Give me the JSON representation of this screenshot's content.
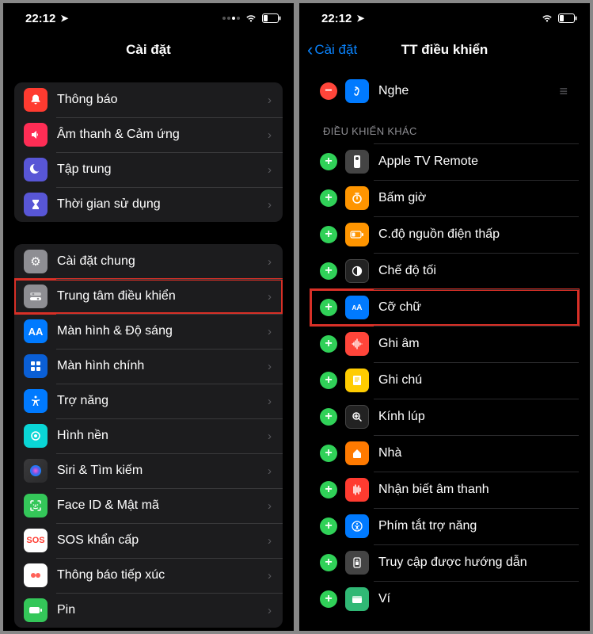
{
  "status": {
    "time": "22:12"
  },
  "left": {
    "title": "Cài đặt",
    "group1": [
      {
        "label": "Thông báo",
        "icon": "bell-icon"
      },
      {
        "label": "Âm thanh & Cảm ứng",
        "icon": "sound-icon"
      },
      {
        "label": "Tập trung",
        "icon": "moon-icon"
      },
      {
        "label": "Thời gian sử dụng",
        "icon": "hourglass-icon"
      }
    ],
    "group2": [
      {
        "label": "Cài đặt chung",
        "icon": "gear-icon"
      },
      {
        "label": "Trung tâm điều khiển",
        "icon": "control-center-icon",
        "highlight": true
      },
      {
        "label": "Màn hình & Độ sáng",
        "icon": "text-size-icon"
      },
      {
        "label": "Màn hình chính",
        "icon": "home-screen-icon"
      },
      {
        "label": "Trợ năng",
        "icon": "accessibility-icon"
      },
      {
        "label": "Hình nền",
        "icon": "wallpaper-icon"
      },
      {
        "label": "Siri & Tìm kiếm",
        "icon": "siri-icon"
      },
      {
        "label": "Face ID & Mật mã",
        "icon": "faceid-icon"
      },
      {
        "label": "SOS khẩn cấp",
        "icon": "sos-icon"
      },
      {
        "label": "Thông báo tiếp xúc",
        "icon": "exposure-icon"
      },
      {
        "label": "Pin",
        "icon": "battery-icon"
      }
    ]
  },
  "right": {
    "back": "Cài đặt",
    "title": "TT điều khiển",
    "included": [
      {
        "label": "Nghe",
        "icon": "ear-icon",
        "action": "remove"
      }
    ],
    "more_header": "ĐIỀU KHIỂN KHÁC",
    "more": [
      {
        "label": "Apple TV Remote",
        "icon": "remote-icon"
      },
      {
        "label": "Bấm giờ",
        "icon": "timer-icon"
      },
      {
        "label": "C.độ nguồn điện thấp",
        "icon": "lowpower-icon"
      },
      {
        "label": "Chế độ tối",
        "icon": "darkmode-icon"
      },
      {
        "label": "Cỡ chữ",
        "icon": "textsize-icon",
        "highlight": true
      },
      {
        "label": "Ghi âm",
        "icon": "voice-memo-icon"
      },
      {
        "label": "Ghi chú",
        "icon": "notes-icon"
      },
      {
        "label": "Kính lúp",
        "icon": "magnifier-icon"
      },
      {
        "label": "Nhà",
        "icon": "home-icon"
      },
      {
        "label": "Nhận biết âm thanh",
        "icon": "sound-recognition-icon"
      },
      {
        "label": "Phím tắt trợ năng",
        "icon": "accessibility-shortcut-icon"
      },
      {
        "label": "Truy cập được hướng dẫn",
        "icon": "guided-access-icon"
      },
      {
        "label": "Ví",
        "icon": "wallet-icon"
      }
    ]
  }
}
